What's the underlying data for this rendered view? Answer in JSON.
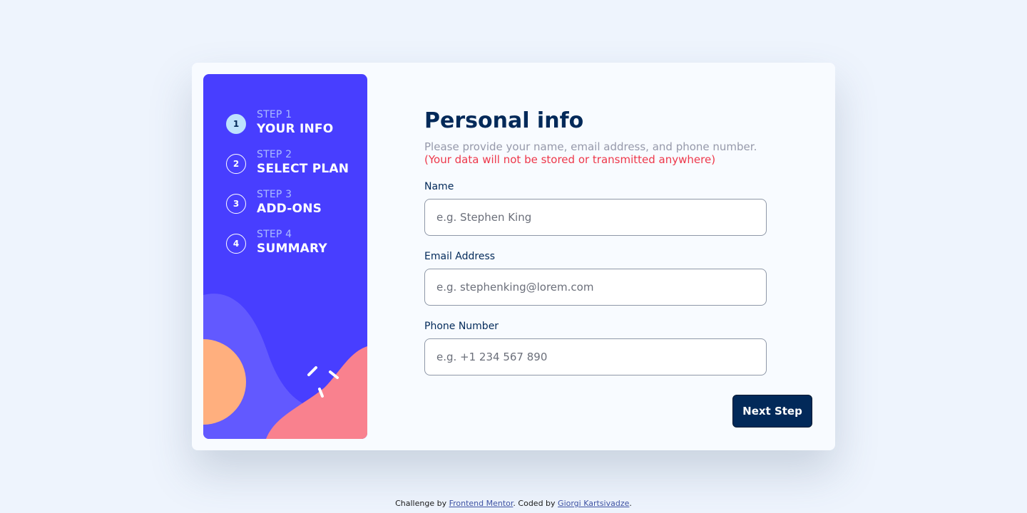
{
  "steps": [
    {
      "number": "1",
      "caption": "STEP 1",
      "title": "YOUR INFO",
      "active": true
    },
    {
      "number": "2",
      "caption": "STEP 2",
      "title": "SELECT PLAN",
      "active": false
    },
    {
      "number": "3",
      "caption": "STEP 3",
      "title": "ADD-ONS",
      "active": false
    },
    {
      "number": "4",
      "caption": "STEP 4",
      "title": "SUMMARY",
      "active": false
    }
  ],
  "form": {
    "title": "Personal info",
    "subtitle": "Please provide your name, email address, and phone number.",
    "warning": "(Your data will not be stored or transmitted anywhere)",
    "fields": [
      {
        "label": "Name",
        "placeholder": "e.g. Stephen King",
        "value": ""
      },
      {
        "label": "Email Address",
        "placeholder": "e.g. stephenking@lorem.com",
        "value": ""
      },
      {
        "label": "Phone Number",
        "placeholder": "e.g. +1 234 567 890",
        "value": ""
      }
    ],
    "next_label": "Next Step"
  },
  "footer": {
    "prefix": "Challenge by ",
    "link1": "Frontend Mentor",
    "middle": ". Coded by ",
    "link2": "Giorgi Kartsivadze",
    "suffix": "."
  },
  "colors": {
    "sidebar_bg": "#483eff",
    "heading": "#022959",
    "warning": "#ee374a",
    "active_step": "#bee2fd",
    "button": "#022959"
  },
  "icons": {
    "decoration": "sidebar-blob-decoration"
  }
}
